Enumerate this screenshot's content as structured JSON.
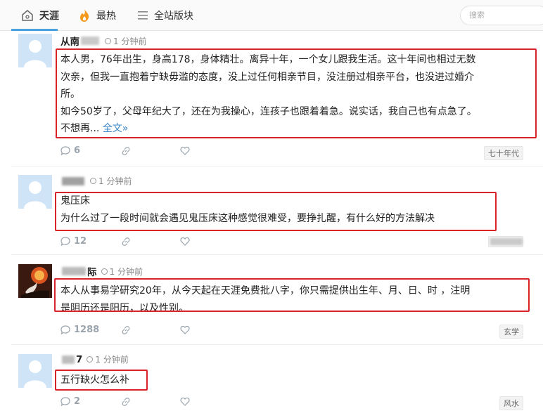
{
  "nav": {
    "tabs": [
      {
        "label": "天涯"
      },
      {
        "label": "最热"
      },
      {
        "label": "全站版块"
      }
    ],
    "search_placeholder": "搜索"
  },
  "posts": [
    {
      "author": "从南",
      "time": "1 分钟前",
      "lines": [
        "本人男，76年出生，身高178，身体精壮。离异十年，一个女儿跟我生活。这十年间也相过无数",
        "次亲，但我一直抱着宁缺毋滥的态度，没上过任何相亲节目，没注册过相亲平台，也没进过婚介",
        "所。",
        "如今50岁了，父母年纪大了，还在为我操心，连孩子也跟着着急。说实话，我自己也有点急了。"
      ],
      "last_line_prefix": "不想再... ",
      "read_more": "全文»",
      "comments": "6",
      "tag": "七十年代"
    },
    {
      "author": "",
      "time": "1 分钟前",
      "lines": [
        "鬼压床",
        "为什么过了一段时间就会遇见鬼压床这种感觉很难受，要挣扎醒，有什么好的方法解决"
      ],
      "comments": "12",
      "tag": ""
    },
    {
      "author": "际",
      "time": "1 分钟前",
      "lines": [
        "本人从事易学研究20年，从今天起在天涯免费批八字，你只需提供出生年、月、日、时 ，注明",
        "是阴历还是阳历，以及性别。"
      ],
      "comments": "1288",
      "tag": "玄学"
    },
    {
      "author": "7",
      "time": "1 分钟前",
      "lines": [
        "五行缺火怎么补"
      ],
      "comments": "2",
      "tag": "风水"
    }
  ]
}
